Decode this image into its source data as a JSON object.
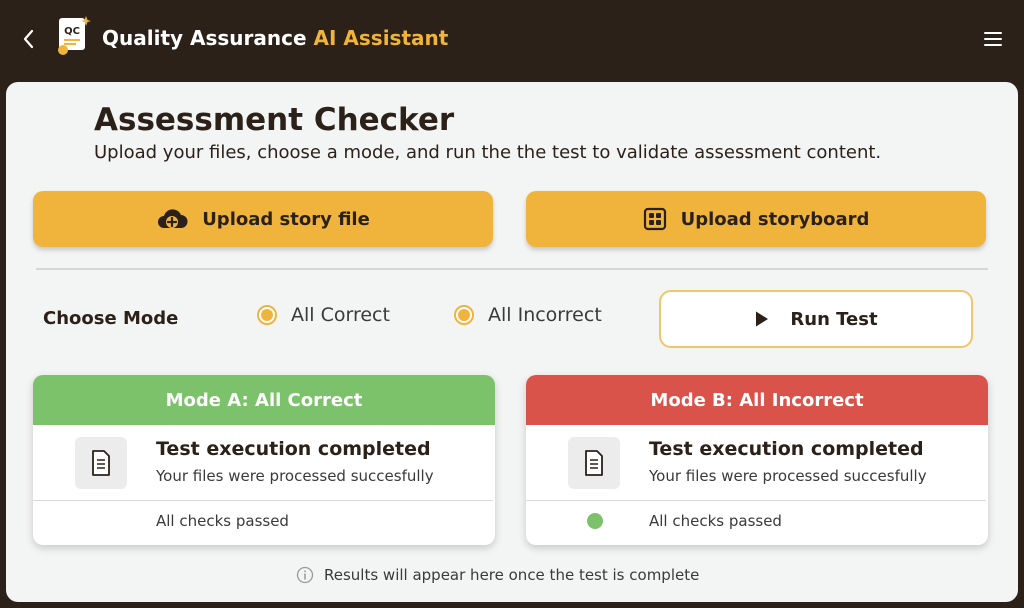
{
  "header": {
    "title_prefix": "Quality Assurance",
    "title_accent": "AI Assistant",
    "logo_text": "QC"
  },
  "main": {
    "title": "Assessment Checker",
    "subtitle": "Upload your files, choose a mode, and run the the test to validate assessment content."
  },
  "uploads": {
    "story_label": "Upload story file",
    "storyboard_label": "Upload storyboard"
  },
  "mode": {
    "label": "Choose Mode",
    "options": [
      "All Correct",
      "All Incorrect"
    ]
  },
  "run_button": {
    "label": "Run Test"
  },
  "results": [
    {
      "header": "Mode A: All Correct",
      "header_color": "#7cc26a",
      "title": "Test execution completed",
      "description": "Your files were processed succesfully",
      "status": "All checks passed"
    },
    {
      "header": "Mode B: All Incorrect",
      "header_color": "#d9534a",
      "title": "Test execution completed",
      "description": "Your files were processed succesfully",
      "status": "All checks passed"
    }
  ],
  "footer_note": "Results will appear here once the test is complete",
  "colors": {
    "accent": "#f0b43c",
    "dark": "#2b2119",
    "success": "#7cc26a",
    "error": "#d9534a"
  },
  "icons": [
    "back-arrow-icon",
    "qc-logo-icon",
    "hamburger-menu-icon",
    "cloud-upload-icon",
    "grid-icon",
    "play-icon",
    "document-icon",
    "info-icon"
  ]
}
